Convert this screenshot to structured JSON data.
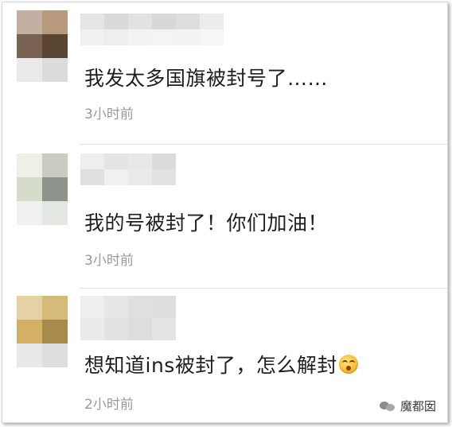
{
  "comments": [
    {
      "text": "我发太多国旗被封号了……",
      "time": "3小时前",
      "avatar_colors": [
        "#c4ada1",
        "#b79a7e",
        "#7a6252",
        "#5a4533",
        "#eaeaea",
        "#dcdcdc"
      ],
      "name_blur_colors": [
        "#e6e6e6",
        "#dadada",
        "#e2e2e2",
        "#d8d8d8",
        "#dedede",
        "#ececec",
        "#f0f0f0",
        "#eeeeee",
        "#f2f2f2",
        "#f4f4f4",
        "#f3f3f3",
        "#f6f6f6"
      ],
      "has_emoji": false
    },
    {
      "text": "我的号被封了！你们加油！",
      "time": "3小时前",
      "avatar_colors": [
        "#efefe6",
        "#cbcbc2",
        "#d5dccb",
        "#8e938b",
        "#f1f1f1",
        "#e4e8e2"
      ],
      "name_blur_colors": [
        "#eeeeee",
        "#e4e4e4",
        "#e8e8e8",
        "#dcdcdc",
        "#e0e0e0",
        "#f0f0f0",
        "#eaeaea",
        "#e2e2e2"
      ],
      "has_emoji": false
    },
    {
      "text": "想知道ins被封了，怎么解封",
      "time": "2小时前",
      "avatar_colors": [
        "#e4d1a6",
        "#d5ba7a",
        "#d3b066",
        "#a98a4d",
        "#e9e9e9",
        "#dedede"
      ],
      "name_blur_colors": [
        "#eeeeee",
        "#e6e6e6",
        "#e0e0e0",
        "#dddddd",
        "#ebebeb",
        "#e2e2e2",
        "#dddddd",
        "#e4e4e4"
      ],
      "has_emoji": true,
      "emoji": "face-with-open-mouth-emoji"
    }
  ],
  "watermark": {
    "label": "魔都囡",
    "icon": "wechat-icon"
  }
}
